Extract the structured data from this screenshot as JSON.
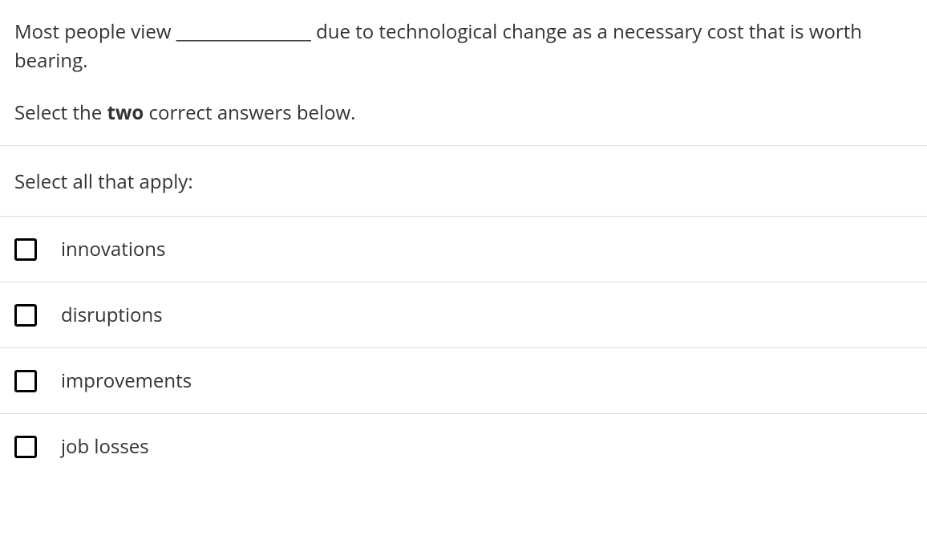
{
  "question": {
    "text": "Most people view ________________ due to technological change as a necessary cost that is worth bearing.",
    "instruction_prefix": "Select the ",
    "instruction_bold": "two",
    "instruction_suffix": " correct answers below."
  },
  "select_all_label": "Select all that apply:",
  "options": [
    {
      "label": "innovations"
    },
    {
      "label": "disruptions"
    },
    {
      "label": "improvements"
    },
    {
      "label": "job losses"
    }
  ]
}
